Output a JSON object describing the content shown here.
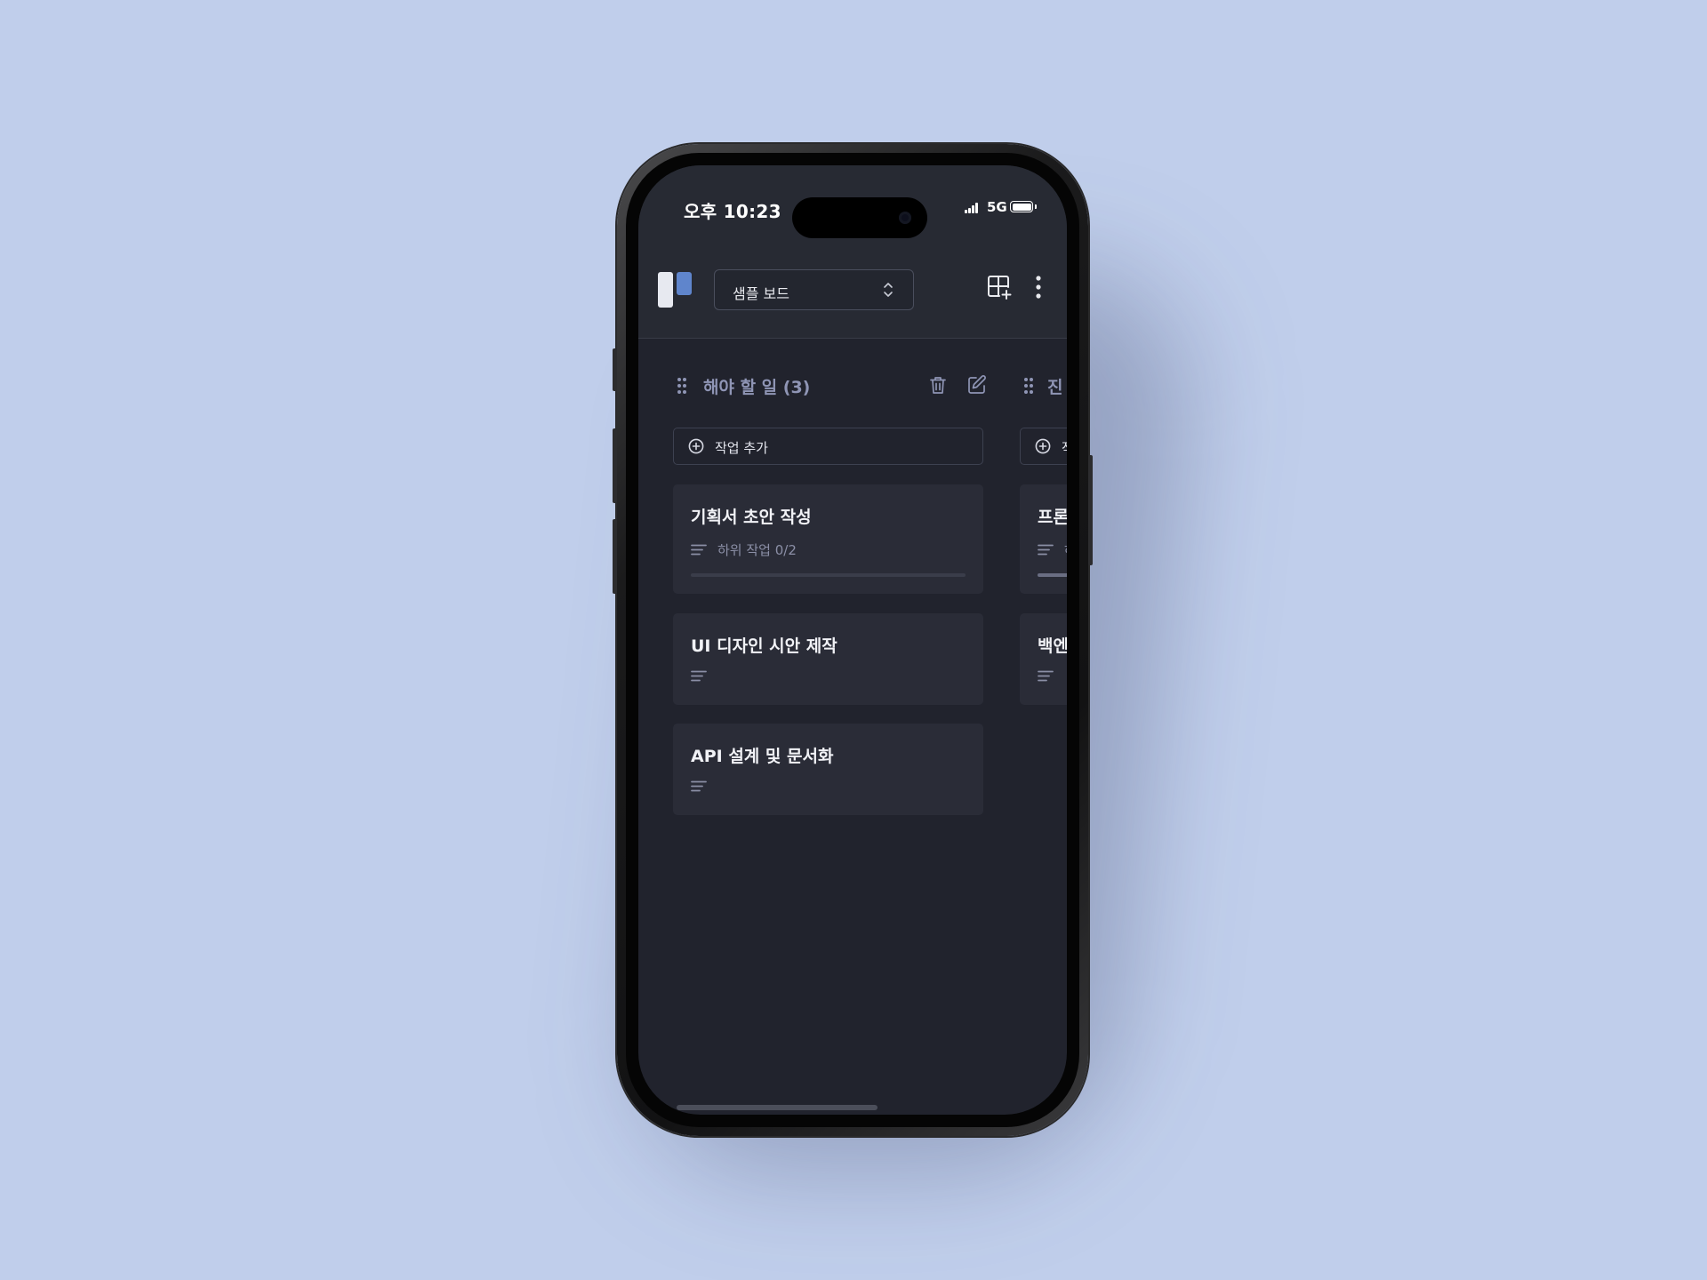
{
  "status_bar": {
    "time": "오후 10:23",
    "network": "5G"
  },
  "header": {
    "board_name": "샘플 보드"
  },
  "columns": [
    {
      "title": "해야 할 일 (3)",
      "add_label": "작업 추가",
      "cards": [
        {
          "title": "기획서 초안 작성",
          "subtasks": "하위 작업 0/2",
          "progress": 0
        },
        {
          "title": "UI 디자인 시안 제작"
        },
        {
          "title": "API 설계 및 문서화"
        }
      ]
    },
    {
      "title": "진",
      "add_label": "작",
      "cards": [
        {
          "title": "프론",
          "subtasks": "하",
          "progress": 0.5
        },
        {
          "title": "백엔"
        }
      ]
    }
  ],
  "colors": {
    "background": "#c0ceeb",
    "screen": "#21232d",
    "card": "#2a2c37",
    "accent": "#5f85cc",
    "column_title": "#8f95b5"
  }
}
